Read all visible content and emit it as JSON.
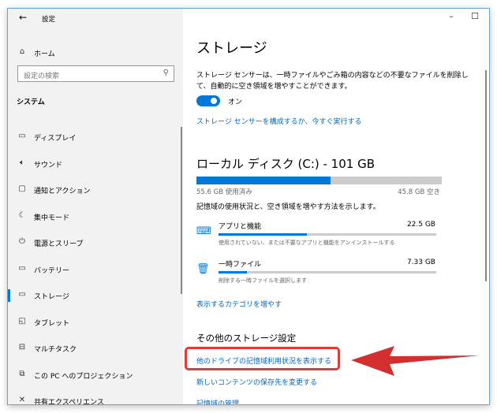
{
  "window": {
    "title": "設定",
    "back_icon": "arrow-left-icon",
    "controls": [
      "minimize",
      "maximize",
      "close"
    ]
  },
  "sidebar": {
    "home": "ホーム",
    "search_placeholder": "設定の検索",
    "section": "システム",
    "items": [
      {
        "label": "ディスプレイ",
        "icon": "monitor-icon"
      },
      {
        "label": "サウンド",
        "icon": "speaker-icon"
      },
      {
        "label": "通知とアクション",
        "icon": "notification-icon"
      },
      {
        "label": "集中モード",
        "icon": "moon-icon"
      },
      {
        "label": "電源とスリープ",
        "icon": "power-icon"
      },
      {
        "label": "バッテリー",
        "icon": "battery-icon"
      },
      {
        "label": "ストレージ",
        "icon": "storage-icon",
        "selected": true
      },
      {
        "label": "タブレット",
        "icon": "tablet-icon"
      },
      {
        "label": "マルチタスク",
        "icon": "multitask-icon"
      },
      {
        "label": "この PC へのプロジェクション",
        "icon": "projection-icon"
      },
      {
        "label": "共有エクスペリエンス",
        "icon": "shared-icon"
      }
    ]
  },
  "main": {
    "title": "ストレージ",
    "sense_desc1": "ストレージ センサーは、一時ファイルやごみ箱の内容などの不要なファイルを削除し",
    "sense_desc2": "て、自動的に空き領域を増やすことができます。",
    "toggle_state": "オン",
    "toggle_on": true,
    "sense_link": "ストレージ センサーを構成するか、今すぐ実行する",
    "disk_title": "ローカル ディスク (C:) - 101 GB",
    "disk_used_fraction": 0.548,
    "used": "55.6 GB 使用済み",
    "free": "45.8 GB 空き",
    "usage_desc": "記憶域の使用状況と、空き領域を増やす方法を示します。",
    "categories": [
      {
        "name": "アプリと機能",
        "size": "22.5 GB",
        "desc": "使用されていない、または不要なアプリと機能をアンインストールする",
        "fraction": 0.405,
        "icon": "apps-icon"
      },
      {
        "name": "一時ファイル",
        "size": "7.33 GB",
        "desc": "削除する一時ファイルを選択します",
        "fraction": 0.13,
        "icon": "trash-icon"
      }
    ],
    "more_categories": "表示するカテゴリを増やす",
    "other_title": "その他のストレージ設定",
    "other_links": [
      "他のドライブの記憶域利用状況を表示する",
      "新しいコンテンツの保存先を変更する",
      "記憶域の管理"
    ]
  },
  "annotation": {
    "highlight_color": "#e53935",
    "arrow_color": "#d32f2f"
  },
  "colors": {
    "accent": "#0078d7",
    "link": "#0067c0"
  }
}
